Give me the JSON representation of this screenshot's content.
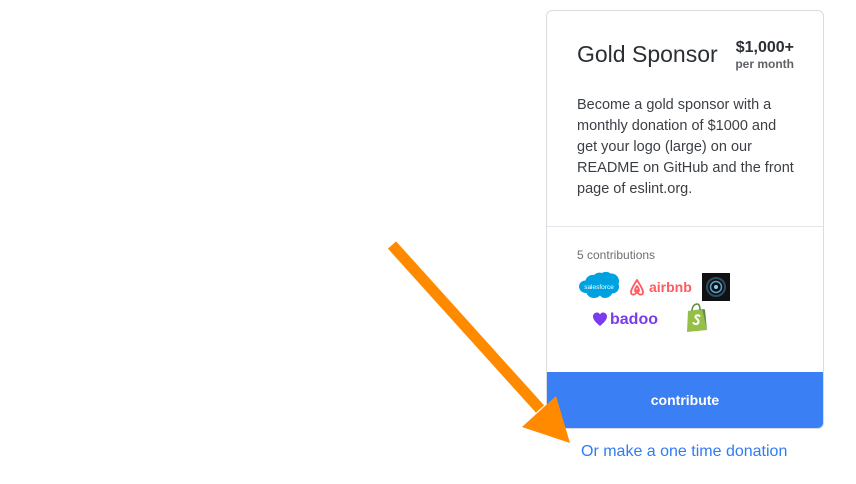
{
  "tier": {
    "title": "Gold Sponsor",
    "price": "$1,000+",
    "period": "per month",
    "description": "Become a gold sponsor with a monthly donation of $1000 and get your logo (large) on our README on GitHub and the front page of eslint.org."
  },
  "contributions": {
    "count_label": "5 contributions",
    "logos": [
      {
        "name": "salesforce",
        "text": "salesforce",
        "color": "#00a1e0"
      },
      {
        "name": "airbnb",
        "text": "airbnb",
        "color": "#ff5a5f"
      },
      {
        "name": "dark-circle-logo",
        "text": "",
        "color": "#0f1114"
      },
      {
        "name": "badoo",
        "text": "badoo",
        "color": "#7c3aed"
      },
      {
        "name": "shopify",
        "text": "",
        "color": "#95bf47"
      }
    ]
  },
  "buttons": {
    "contribute": "contribute",
    "one_time": "Or make a one time donation"
  },
  "colors": {
    "accent": "#3b7ff5",
    "link": "#2f7cf3",
    "arrow": "#ff8a00"
  }
}
